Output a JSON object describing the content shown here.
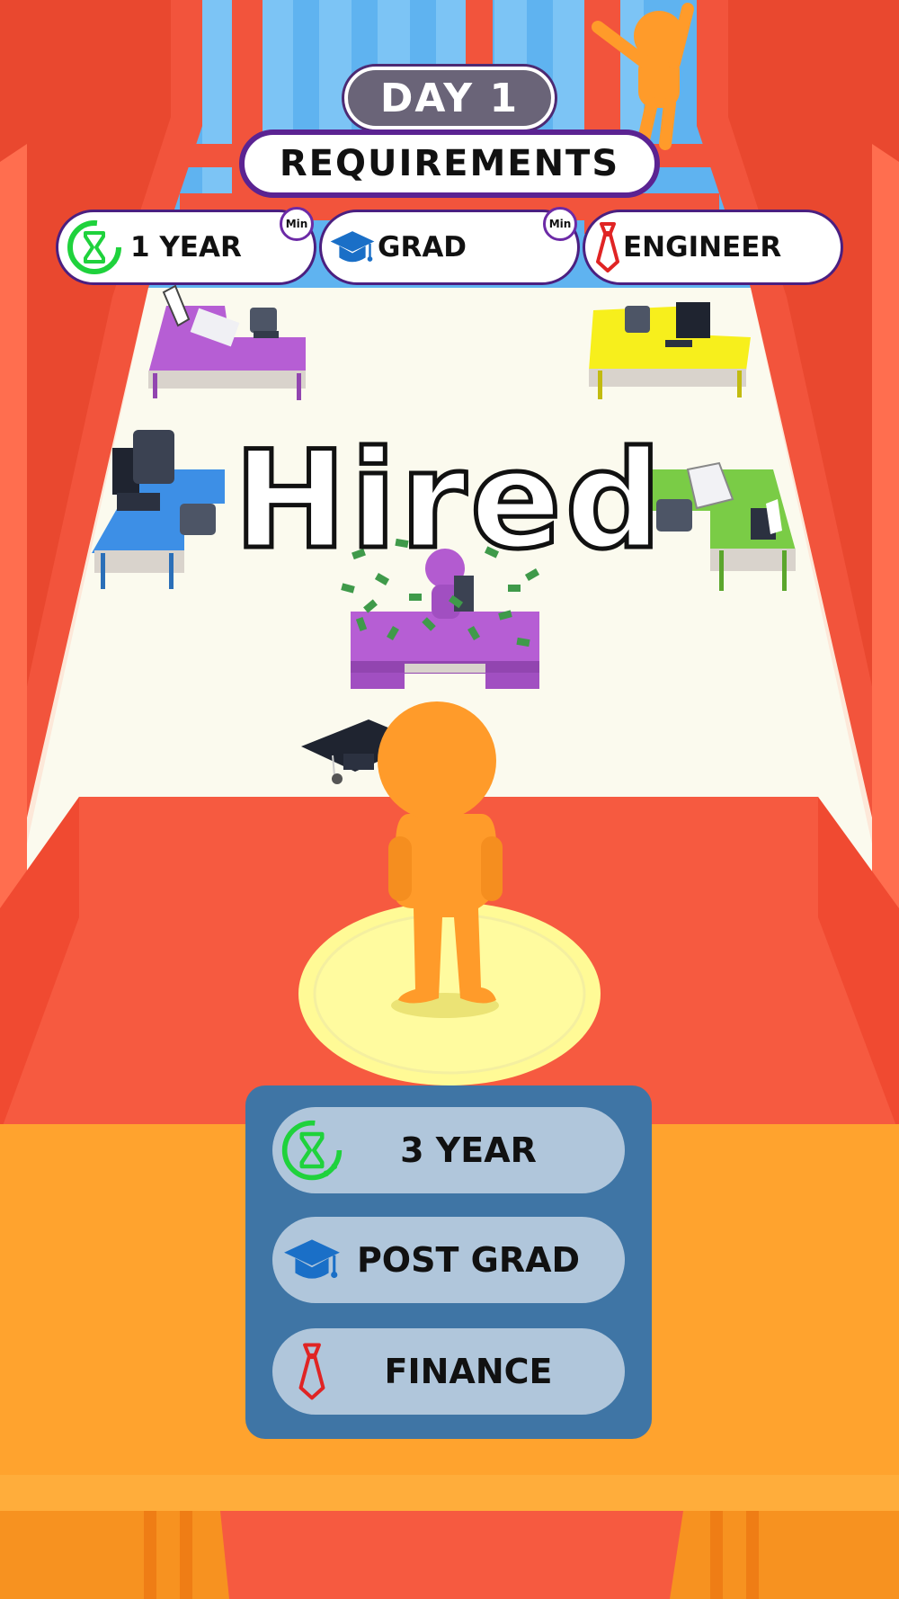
{
  "header": {
    "day_label": "DAY 1",
    "requirements_title": "REQUIREMENTS"
  },
  "requirements": [
    {
      "icon": "hourglass-icon",
      "label": "1 YEAR",
      "badge": "Min"
    },
    {
      "icon": "graduation-cap-icon",
      "label": "GRAD",
      "badge": "Min"
    },
    {
      "icon": "necktie-icon",
      "label": "ENGINEER"
    }
  ],
  "status_text": "Hired",
  "candidate_options": [
    {
      "icon": "hourglass-icon",
      "label": "3 YEAR"
    },
    {
      "icon": "graduation-cap-icon",
      "label": "POST GRAD"
    },
    {
      "icon": "necktie-icon",
      "label": "FINANCE"
    }
  ],
  "colors": {
    "hourglass": "#1fd23c",
    "cap": "#1a6fc7",
    "tie": "#e02424",
    "panel": "#3f75a5",
    "option": "#b0c6db",
    "player": "#ff9b2a",
    "hired_person": "#b35bd0"
  }
}
